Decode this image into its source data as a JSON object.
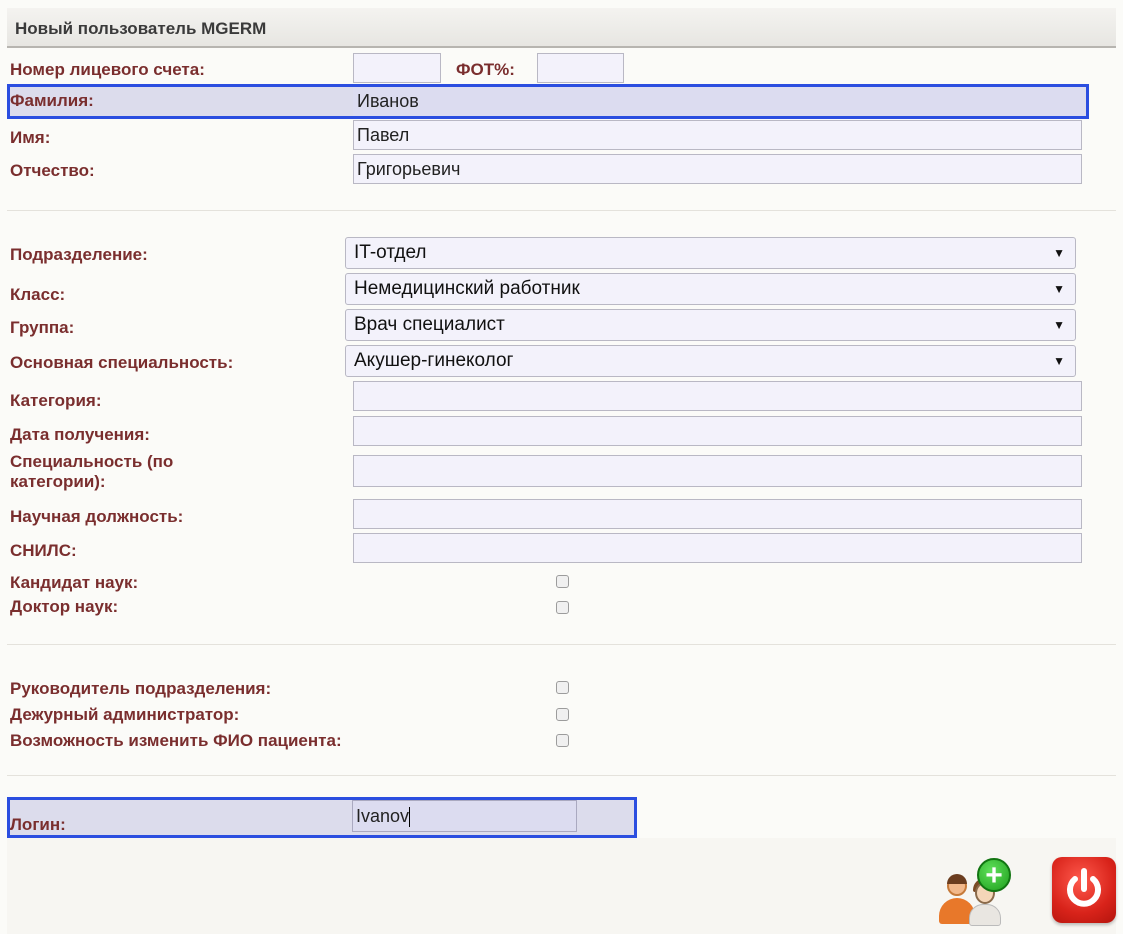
{
  "window": {
    "title": "Новый пользователь MGERM"
  },
  "form": {
    "account_label": "Номер лицевого счета:",
    "account_value": "",
    "fot_label": "ФОТ%:",
    "fot_value": "",
    "surname_label": "Фамилия:",
    "surname_value": "Иванов",
    "name_label": "Имя:",
    "name_value": "Павел",
    "patronymic_label": "Отчество:",
    "patronymic_value": "Григорьевич",
    "department_label": "Подразделение:",
    "department_value": "IT-отдел",
    "class_label": "Класс:",
    "class_value": "Немедицинский работник",
    "group_label": "Группа:",
    "group_value": "Врач специалист",
    "specialty_label": "Основная специальность:",
    "specialty_value": "Акушер-гинеколог",
    "category_label": "Категория:",
    "category_value": "",
    "date_label": "Дата получения:",
    "date_value": "",
    "cat_specialty_label_1": "Специальность (по",
    "cat_specialty_label_2": "категории):",
    "cat_specialty_value": "",
    "sci_position_label": "Научная должность:",
    "sci_position_value": "",
    "snils_label": "СНИЛС:",
    "snils_value": "",
    "candidate_label": "Кандидат наук:",
    "doctor_label": "Доктор наук:",
    "head_label": "Руководитель подразделения:",
    "duty_admin_label": "Дежурный администратор:",
    "change_fio_label": "Возможность изменить ФИО пациента:",
    "login_label": "Логин:",
    "login_value": "Ivanov"
  },
  "checkboxes": {
    "candidate": false,
    "doctor": false,
    "head": false,
    "duty_admin": false,
    "change_fio": false
  },
  "icons": {
    "add_user": "add-user-icon",
    "power": "power-icon"
  },
  "colors": {
    "label": "#7a2e2e",
    "highlight": "#2b4ee0",
    "power_button": "#d8231a",
    "add_badge": "#1e9e1c"
  }
}
